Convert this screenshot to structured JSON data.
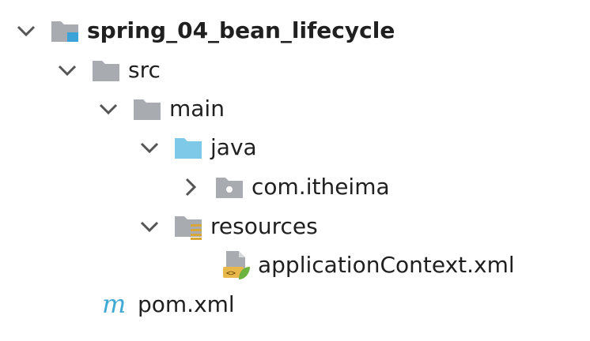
{
  "tree": {
    "project": {
      "label": "spring_04_bean_lifecycle",
      "icon": "module-folder-icon",
      "expanded": true
    },
    "src": {
      "label": "src",
      "icon": "folder-icon",
      "expanded": true
    },
    "main": {
      "label": "main",
      "icon": "folder-icon",
      "expanded": true
    },
    "java": {
      "label": "java",
      "icon": "source-root-folder-icon",
      "expanded": true,
      "color": "#7ec8e8"
    },
    "package": {
      "label": "com.itheima",
      "icon": "package-icon",
      "expanded": false
    },
    "resources": {
      "label": "resources",
      "icon": "resources-folder-icon",
      "expanded": true
    },
    "app_context": {
      "label": "applicationContext.xml",
      "icon": "spring-xml-file-icon"
    },
    "pom": {
      "label": "pom.xml",
      "icon": "maven-icon",
      "color": "#3fa9d6"
    }
  },
  "colors": {
    "folder_gray": "#a8acb0",
    "source_root_blue": "#7ec8e8",
    "module_accent": "#3ba3d8",
    "chevron": "#555555"
  }
}
